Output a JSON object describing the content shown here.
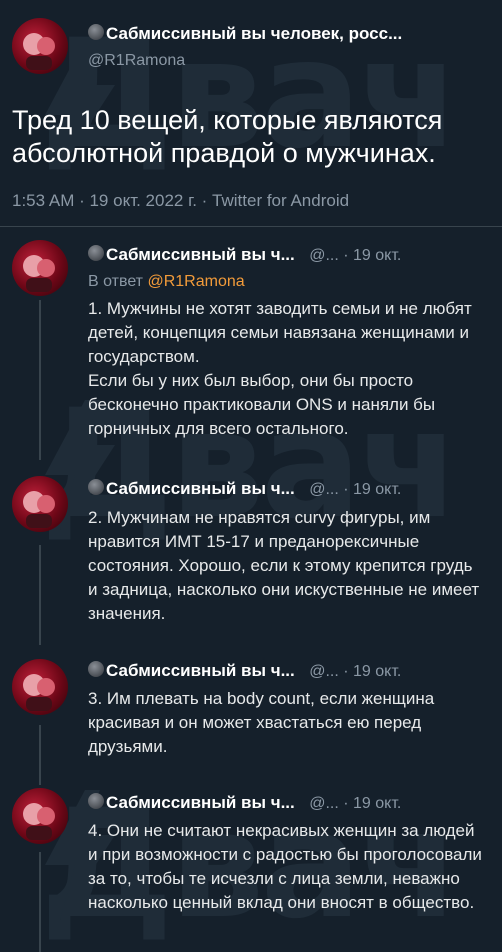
{
  "main_tweet": {
    "display_name": "Сабмиссивный вы человек, росс...",
    "handle": "@R1Ramona",
    "text": "Тред 10 вещей, которые являются абсолютной правдой о мужчинах.",
    "timestamp": "1:53 AM · 19 окт. 2022 г. · Twitter for Android"
  },
  "replies": [
    {
      "display_name": "Сабмиссивный вы ч...",
      "meta": "@... · 19 окт.",
      "reply_prefix": "В ответ",
      "reply_handle": "@R1Ramona",
      "text": "1. Мужчины не хотят заводить семьи и не любят детей, концепция семьи навязана женщинами и государством.\nЕсли бы у них был выбор, они бы просто бесконечно практиковали ONS и наняли бы горничных для всего остального."
    },
    {
      "display_name": "Сабмиссивный вы ч...",
      "meta": "@... · 19 окт.",
      "text": "2. Мужчинам не нравятся curvy фигуры, им нравится ИМТ 15-17 и преданорексичные состояния. Хорошо, если к этому крепится грудь и задница, насколько они искуственные не имеет значения."
    },
    {
      "display_name": "Сабмиссивный вы ч...",
      "meta": "@... · 19 окт.",
      "text": "3. Им плевать на body count, если женщина красивая и он может хвастаться ею перед друзьями."
    },
    {
      "display_name": "Сабмиссивный вы ч...",
      "meta": "@... · 19 окт.",
      "text": "4. Они не считают некрасивых женщин за людей и при возможности с радостью бы проголосовали за то, чтобы те исчезли с лица земли, неважно насколько ценный вклад они вносят в общество."
    }
  ],
  "watermark": {
    "text": "Двач",
    "color": "#1f2c38"
  },
  "colors": {
    "background": "#15202b",
    "accent": "#f29b3a",
    "secondary_text": "#8b98a5",
    "divider": "#38444d"
  }
}
